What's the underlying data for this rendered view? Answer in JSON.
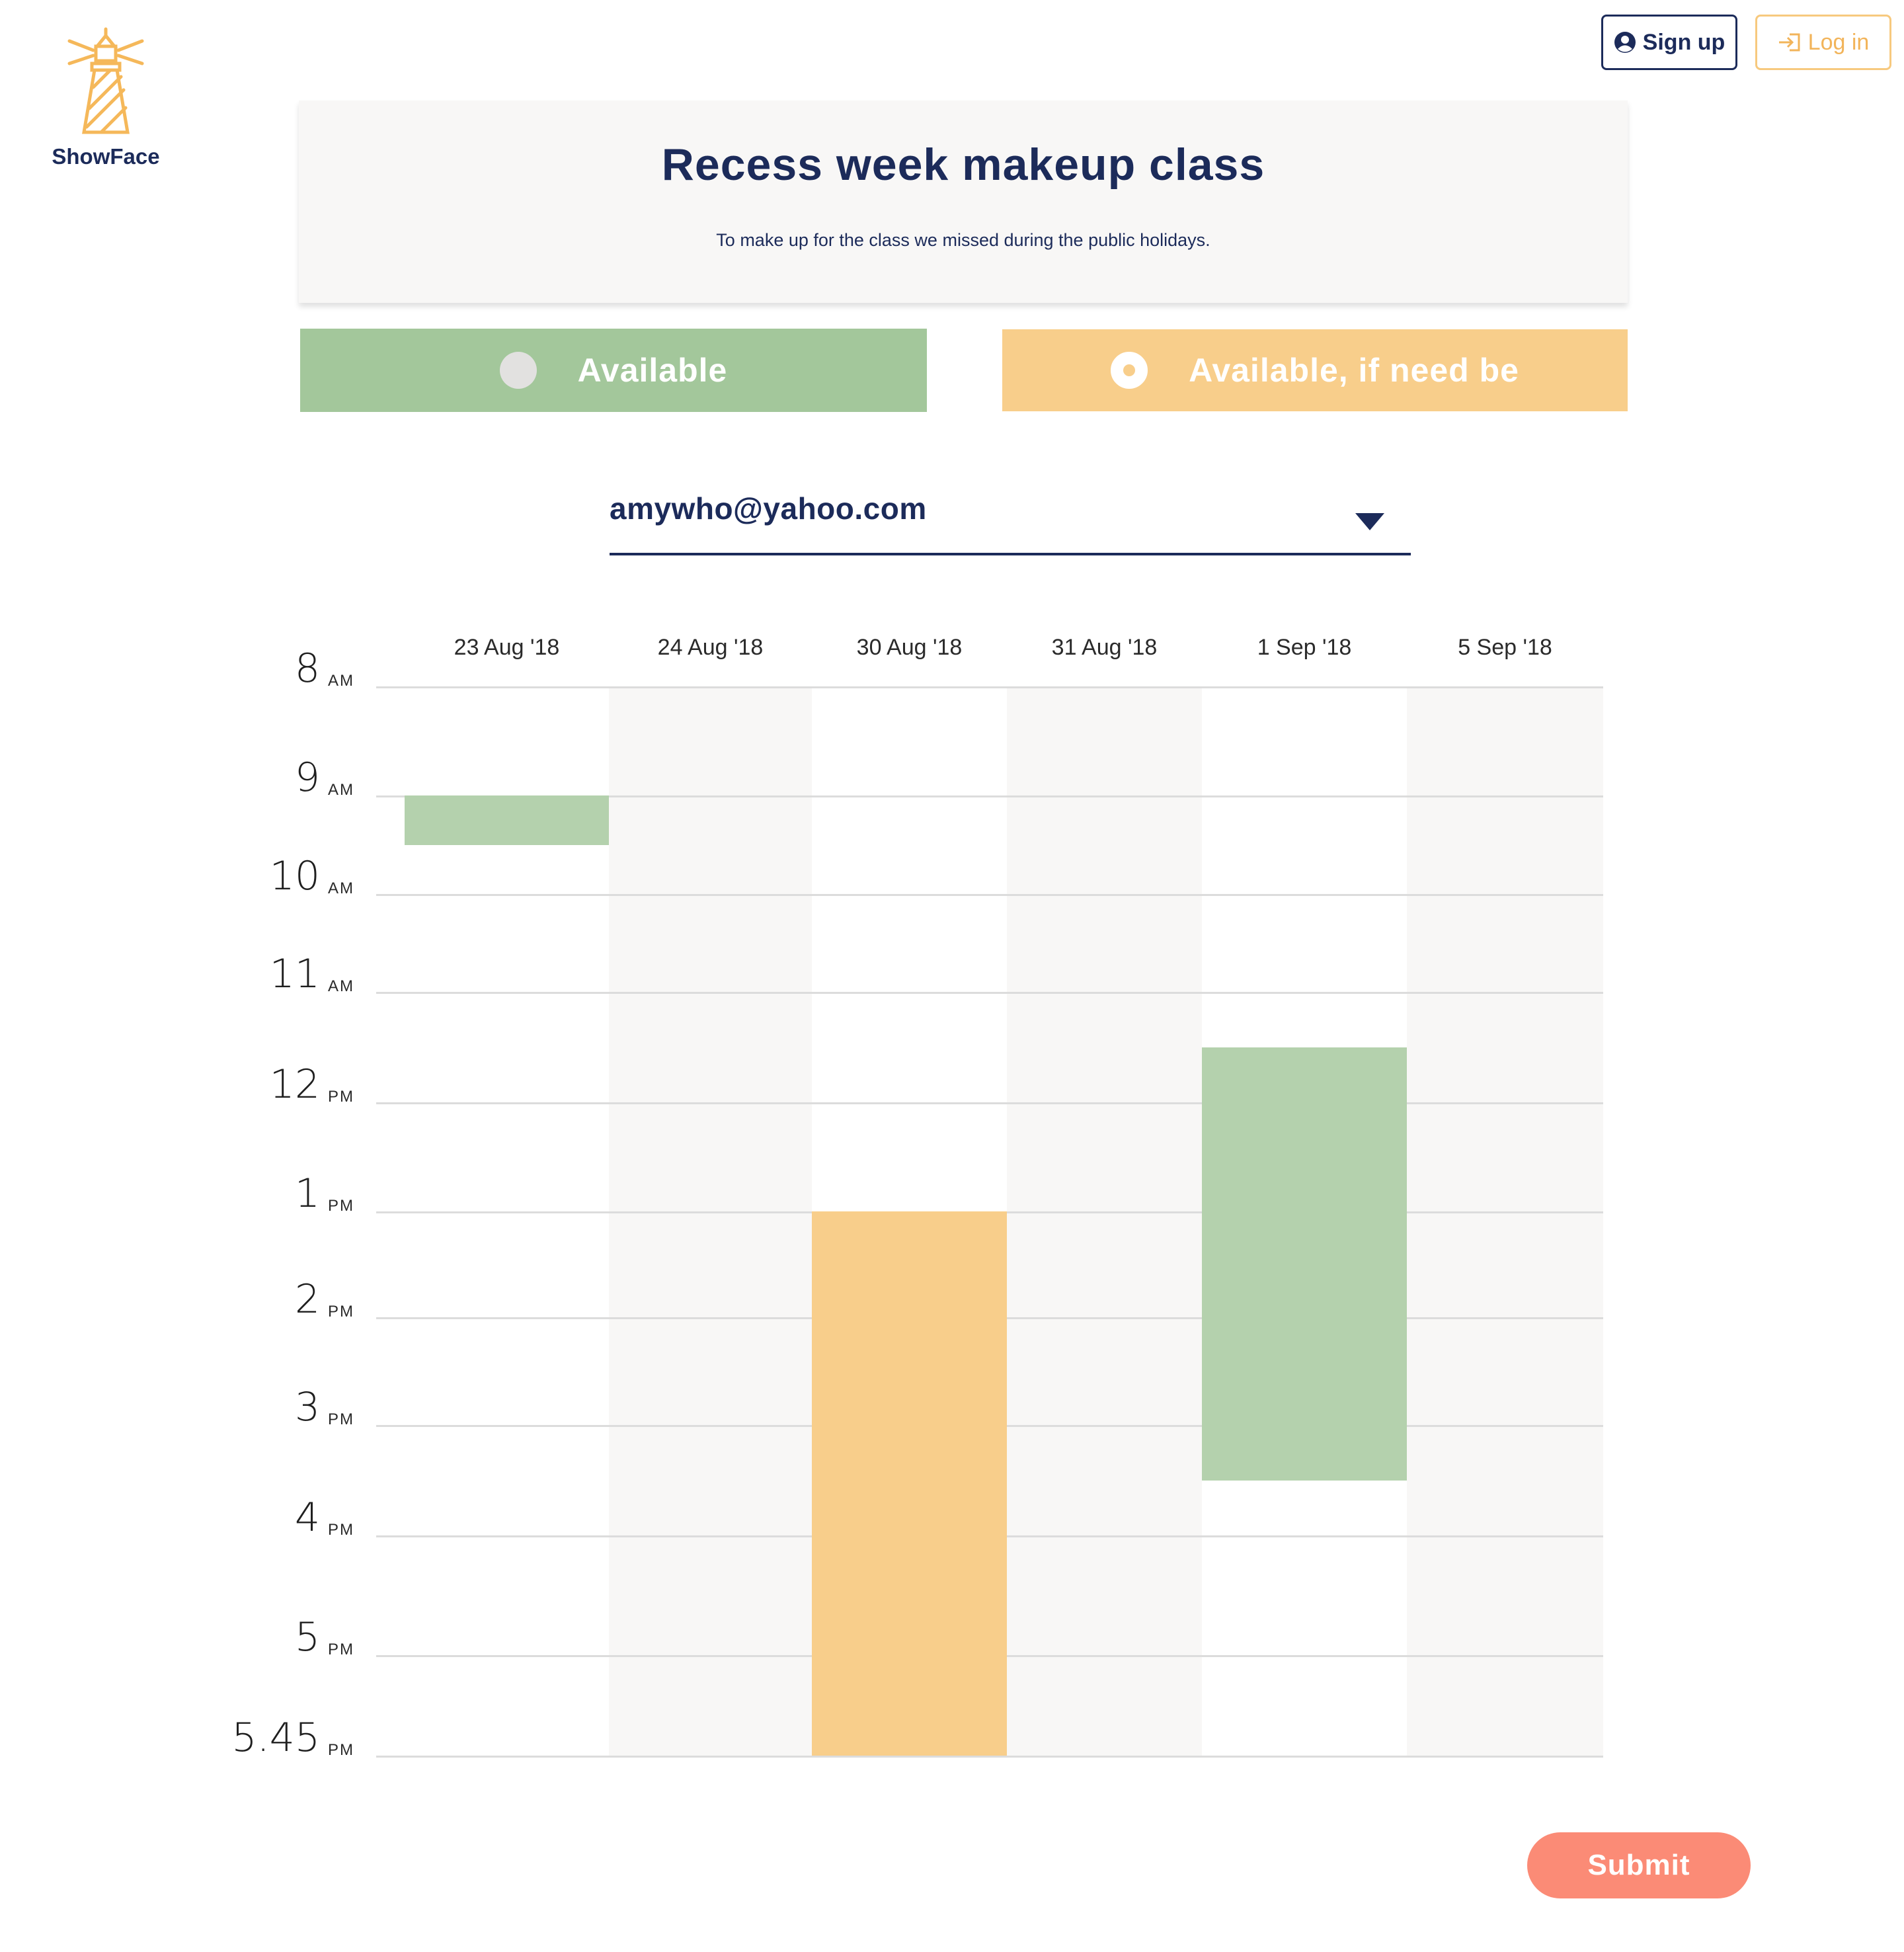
{
  "brand": {
    "name": "ShowFace",
    "logo_icon": "lighthouse-icon",
    "logo_color": "#f5b85a"
  },
  "header_buttons": {
    "signup_label": "Sign up",
    "signup_icon": "user-circle-icon",
    "login_label": "Log in",
    "login_icon": "sign-in-icon"
  },
  "event": {
    "title": "Recess week makeup class",
    "description": "To make up for the class we missed during the public holidays."
  },
  "modes": [
    {
      "label": "Available",
      "color": "#a3c79b",
      "selected": false
    },
    {
      "label": "Available, if need be",
      "color": "#f8ce8b",
      "selected": true
    }
  ],
  "user_select": {
    "value": "amywho@yahoo.com"
  },
  "schedule": {
    "dates": [
      "23 Aug '18",
      "24 Aug '18",
      "30 Aug '18",
      "31 Aug '18",
      "1 Sep '18",
      "5 Sep '18"
    ],
    "time_rows": [
      {
        "num": "8",
        "period": "AM"
      },
      {
        "num": "9",
        "period": "AM"
      },
      {
        "num": "10",
        "period": "AM"
      },
      {
        "num": "11",
        "period": "AM"
      },
      {
        "num": "12",
        "period": "PM"
      },
      {
        "num": "1",
        "period": "PM"
      },
      {
        "num": "2",
        "period": "PM"
      },
      {
        "num": "3",
        "period": "PM"
      },
      {
        "num": "4",
        "period": "PM"
      },
      {
        "num": "5",
        "period": "PM"
      },
      {
        "num": "5.45",
        "period": "PM"
      }
    ],
    "slots": [
      {
        "date": "23 Aug '18",
        "type": "available",
        "start": "9:00 AM",
        "end": "9:30 AM"
      },
      {
        "date": "30 Aug '18",
        "type": "ifneed",
        "start": "1:00 PM",
        "end": "5:45 PM"
      },
      {
        "date": "1 Sep '18",
        "type": "available",
        "start": "11:30 AM",
        "end": "3:30 PM"
      }
    ],
    "colors": {
      "available": "#b4d1ad",
      "ifneed": "#f8ce8b"
    }
  },
  "submit_label": "Submit"
}
